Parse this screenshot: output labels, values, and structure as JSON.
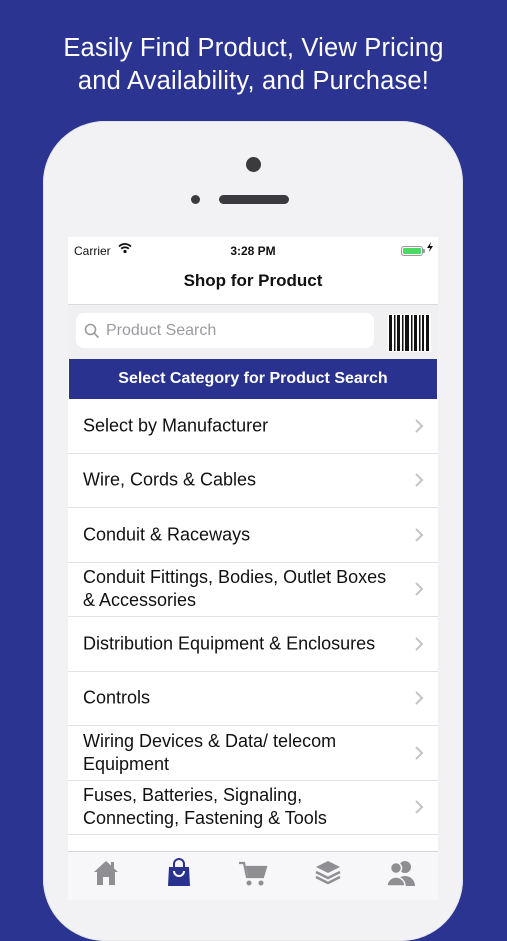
{
  "promo": {
    "line1": "Easily Find Product, View Pricing",
    "line2": "and Availability, and Purchase!"
  },
  "status_bar": {
    "carrier": "Carrier",
    "time": "3:28 PM"
  },
  "nav": {
    "title": "Shop for Product"
  },
  "search": {
    "placeholder": "Product Search"
  },
  "category_header": "Select Category for Product Search",
  "categories": [
    {
      "label": "Select by Manufacturer"
    },
    {
      "label": "Wire, Cords & Cables"
    },
    {
      "label": "Conduit & Raceways"
    },
    {
      "label": "Conduit Fittings, Bodies, Outlet Boxes & Accessories"
    },
    {
      "label": "Distribution Equipment & Enclosures"
    },
    {
      "label": "Controls"
    },
    {
      "label": "Wiring Devices & Data/ telecom Equipment"
    },
    {
      "label": "Fuses, Batteries, Signaling, Connecting, Fastening & Tools"
    }
  ],
  "tabs": [
    {
      "icon": "home-icon",
      "active": false
    },
    {
      "icon": "shopping-bag-icon",
      "active": true
    },
    {
      "icon": "cart-icon",
      "active": false
    },
    {
      "icon": "layers-icon",
      "active": false
    },
    {
      "icon": "contacts-icon",
      "active": false
    }
  ],
  "colors": {
    "background": "#2b3490",
    "header_bar": "#29338f",
    "tab_active": "#29338f",
    "tab_inactive": "#8e8e93",
    "battery": "#4cd964"
  }
}
